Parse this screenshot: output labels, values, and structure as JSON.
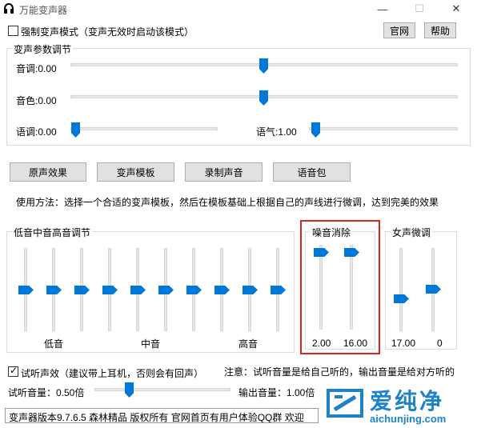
{
  "window": {
    "title": "万能变声器",
    "min": "—",
    "max": "☐",
    "close": "✕"
  },
  "top": {
    "force_mode": "强制变声模式（变声无效时启动该模式）",
    "force_checked": false,
    "site_btn": "官网",
    "help_btn": "帮助"
  },
  "params": {
    "title": "变声参数调节",
    "pitch": {
      "label": "音调:0.00",
      "value": 0.5
    },
    "timbre": {
      "label": "音色:0.00",
      "value": 0.5
    },
    "tone": {
      "label": "语调:0.00",
      "value": 0.02
    },
    "mood": {
      "label": "语气:1.00",
      "value": 0.02
    }
  },
  "buttons": {
    "original": "原声效果",
    "template": "变声模板",
    "record": "录制声音",
    "voice_pack": "语音包"
  },
  "usage": "使用方法：选择一个合适的变声模板，然后在模板基础上根据自己的声线进行微调，达到完美的效果",
  "eq": {
    "title": "低音中音高音调节",
    "low": "低音",
    "mid": "中音",
    "high": "高音",
    "bands": 10,
    "level": 0.5
  },
  "noise": {
    "title": "噪音消除",
    "val1": "2.00",
    "val2": "16.00",
    "level1": 0.05,
    "level2": 0.05
  },
  "female": {
    "title": "女声微调",
    "val1": "17.00",
    "val2": "0",
    "level1": 0.6,
    "level2": 0.5
  },
  "monitor": {
    "label": "试听声效（建议带上耳机，否则会有回声）",
    "checked": true,
    "note": "注意：试听音量是给自己听的，输出音量是给对方听的"
  },
  "volume": {
    "listen": "试听音量：0.50倍",
    "listen_level": 0.5,
    "output": "输出音量：1.00倍"
  },
  "status": {
    "text": "变声器版本9.7.6.5   森林精品  版权所有   官网首页有用户体验QQ群 欢迎"
  },
  "watermark": {
    "title": "爱纯净",
    "url": "aichunjing.com",
    "color": "#1e82c8"
  },
  "colors": {
    "accent": "#0078d7",
    "highlight": "#d9251d"
  }
}
